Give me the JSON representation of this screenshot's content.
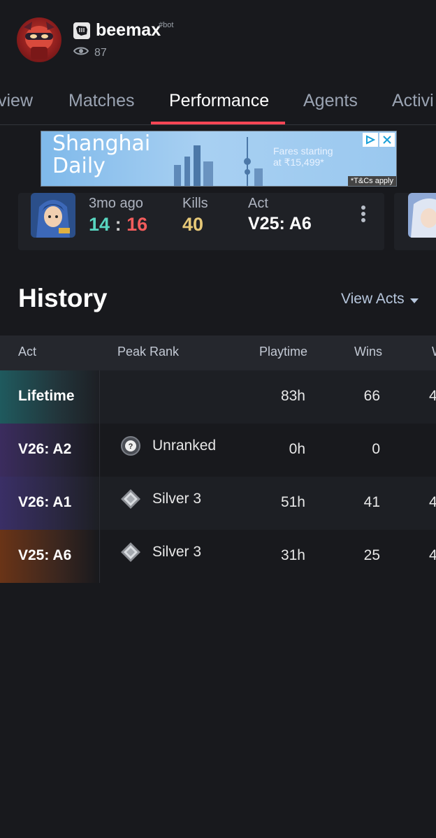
{
  "profile": {
    "username": "beemax",
    "tag": "#bot",
    "views": "87"
  },
  "tabs": [
    {
      "label": "view",
      "active": false
    },
    {
      "label": "Matches",
      "active": false
    },
    {
      "label": "Performance",
      "active": true
    },
    {
      "label": "Agents",
      "active": false
    },
    {
      "label": "Activi",
      "active": false
    }
  ],
  "ad": {
    "brand_line1": "Shanghai",
    "brand_line2": "Daily",
    "fares_line1": "Fares starting",
    "fares_line2": "at ₹15,499*",
    "tc": "*T&Cs apply"
  },
  "match": {
    "time": "3mo ago",
    "score_won": "14",
    "score_sep": ":",
    "score_lost": "16",
    "kills_label": "Kills",
    "kills": "40",
    "act_label": "Act",
    "act": "V25: A6"
  },
  "history": {
    "title": "History",
    "view_acts": "View Acts",
    "columns": [
      "Act",
      "Peak Rank",
      "Playtime",
      "Wins",
      "W"
    ],
    "rows": [
      {
        "act": "Lifetime",
        "rank": "",
        "playtime": "83h",
        "wins": "66",
        "extra": "4"
      },
      {
        "act": "V26: A2",
        "rank": "Unranked",
        "playtime": "0h",
        "wins": "0",
        "extra": ""
      },
      {
        "act": "V26: A1",
        "rank": "Silver 3",
        "playtime": "51h",
        "wins": "41",
        "extra": "4"
      },
      {
        "act": "V25: A6",
        "rank": "Silver 3",
        "playtime": "31h",
        "wins": "25",
        "extra": "4"
      }
    ]
  },
  "colors": {
    "accent": "#ff4655",
    "win": "#58d5c0",
    "loss": "#f25c5c",
    "kills": "#e6c878",
    "background": "#18191d"
  }
}
